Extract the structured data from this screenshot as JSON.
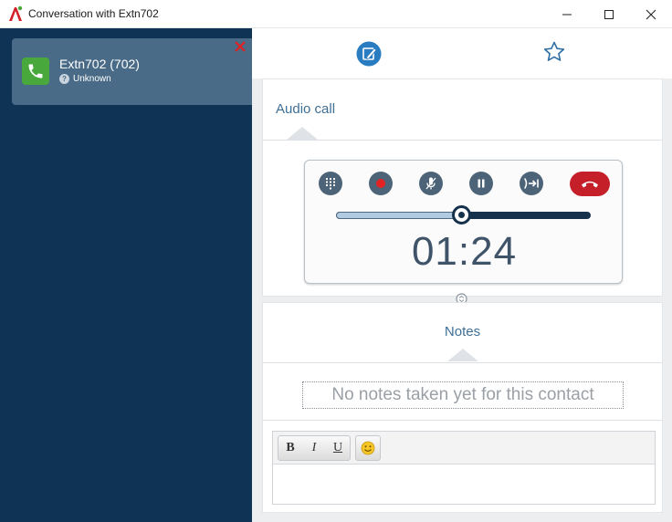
{
  "window": {
    "title": "Conversation with Extn702"
  },
  "colors": {
    "sidebar": "#0e3355",
    "contact_card": "#4a6b87",
    "phone_green": "#48a83c",
    "accent": "#3f6f95",
    "hangup_red": "#c51f2a",
    "close_red": "#e02020"
  },
  "contact": {
    "name": "Extn702 (702)",
    "status": "Unknown",
    "icon": "phone-icon"
  },
  "toolbar": {
    "icons": [
      "edit-notes-icon",
      "star-icon"
    ]
  },
  "call": {
    "section_title": "Audio call",
    "buttons": [
      "dialpad-icon",
      "record-icon",
      "mute-microphone-icon",
      "pause-icon",
      "transfer-icon",
      "hangup-icon"
    ],
    "volume_level": 0.49,
    "timer": "01:24"
  },
  "notes": {
    "section_title": "Notes",
    "empty_message": "No notes taken yet for this contact",
    "editor": {
      "bold_label": "B",
      "italic_label": "I",
      "underline_label": "U",
      "emoji_icon": "smiley-icon",
      "body": ""
    }
  }
}
